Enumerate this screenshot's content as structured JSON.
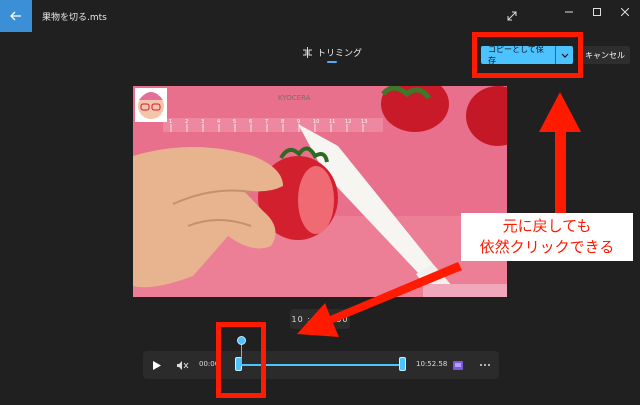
{
  "window": {
    "title": "果物を切る.mts"
  },
  "tab": {
    "label": "トリミング"
  },
  "actions": {
    "save_copy_label": "コピーとして保存",
    "cancel_label": "キャンセル"
  },
  "player": {
    "timecode": "10 : 5_ : 50",
    "start_time": "00:00",
    "end_time": "10:52.58",
    "playhead_fraction": 0.01
  },
  "video": {
    "brand_text": "KYOCERA",
    "ruler_numbers": [
      "1",
      "2",
      "3",
      "4",
      "5",
      "6",
      "7",
      "8",
      "9",
      "10",
      "11",
      "12",
      "13"
    ]
  },
  "annotation": {
    "line1": "元に戻しても",
    "line2": "依然クリックできる"
  },
  "colors": {
    "accent": "#4cc2ff",
    "highlight": "#ff1a00",
    "background": "#202020",
    "back_button": "#3a8fd6"
  }
}
